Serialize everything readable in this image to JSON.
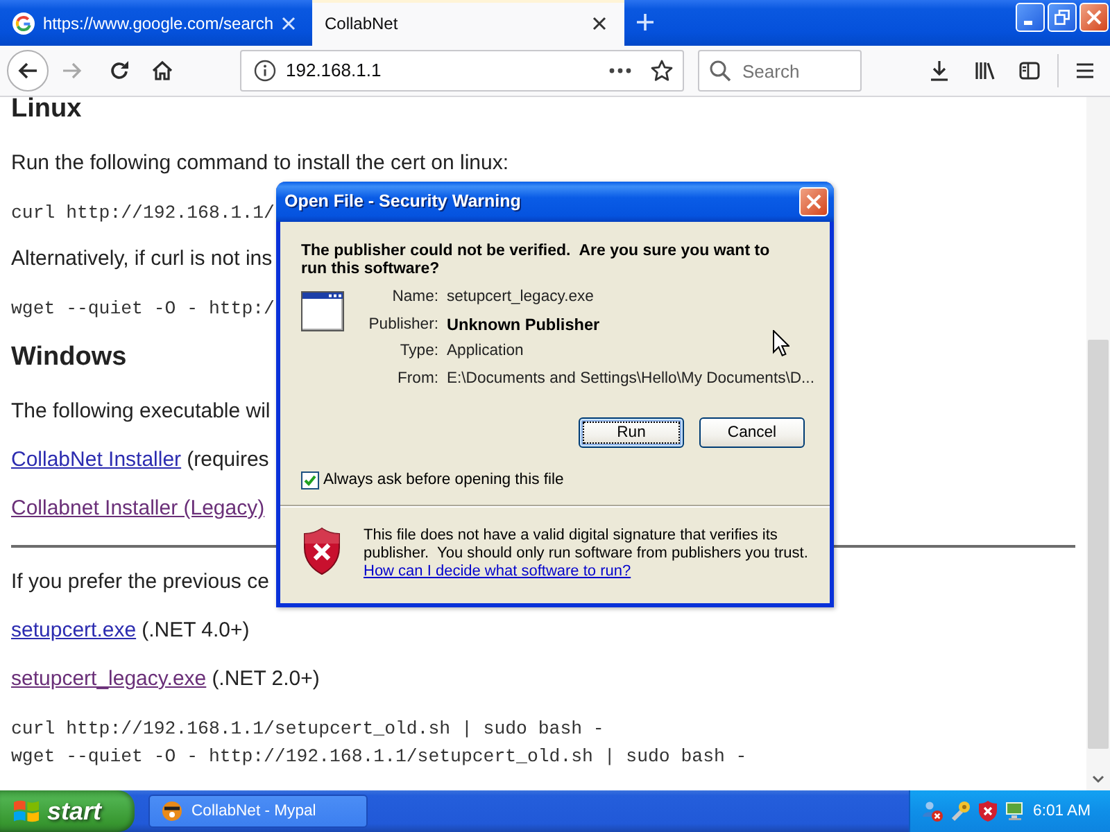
{
  "browser": {
    "tabs": [
      {
        "title": "https://www.google.com/search",
        "favicon": true,
        "selected": false
      },
      {
        "title": "CollabNet",
        "favicon": false,
        "selected": true
      }
    ],
    "url": "192.168.1.1",
    "search": {
      "placeholder": "Search"
    }
  },
  "page": {
    "blocks": [
      {
        "kind": "heading",
        "text": "Linux"
      },
      {
        "kind": "paragraph",
        "text": "Run the following command to install the cert on linux:"
      },
      {
        "kind": "code",
        "lines": [
          "curl http://192.168.1.1/"
        ]
      },
      {
        "kind": "paragraph",
        "text": "Alternatively, if curl is not ins"
      },
      {
        "kind": "code",
        "lines": [
          "wget --quiet -O - http:/"
        ]
      },
      {
        "kind": "heading",
        "text": "Windows"
      },
      {
        "kind": "paragraph",
        "text": "The following executable wil"
      },
      {
        "kind": "link",
        "link": "CollabNet Installer",
        "visited": false,
        "text": "(requires"
      },
      {
        "kind": "link",
        "link": "Collabnet Installer (Legacy)",
        "visited": true
      },
      {
        "kind": "rule"
      },
      {
        "kind": "paragraph",
        "text": "If you prefer the previous ce"
      },
      {
        "kind": "link",
        "link": "setupcert.exe",
        "visited": false,
        "text": "(.NET 4.0+)"
      },
      {
        "kind": "link",
        "link": "setupcert_legacy.exe",
        "visited": true,
        "text": "(.NET 2.0+)"
      },
      {
        "kind": "code",
        "lines": [
          "curl http://192.168.1.1/setupcert_old.sh | sudo bash -",
          "wget --quiet -O - http://192.168.1.1/setupcert_old.sh | sudo bash -"
        ]
      }
    ]
  },
  "dialog": {
    "title": "Open File - Security Warning",
    "message": "The publisher could not be verified.  Are you sure you want to run this software?",
    "fields": [
      {
        "label": "Name:",
        "value": "setupcert_legacy.exe",
        "emphasized": false
      },
      {
        "label": "Publisher:",
        "value": "Unknown Publisher",
        "emphasized": true
      },
      {
        "label": "Type:",
        "value": "Application",
        "emphasized": false
      },
      {
        "label": "From:",
        "value": "E:\\Documents and Settings\\Hello\\My Documents\\D...",
        "emphasized": false
      }
    ],
    "buttons": [
      {
        "label": "Run",
        "focused": true
      },
      {
        "label": "Cancel",
        "focused": false
      }
    ],
    "checkbox": {
      "label": "Always ask before opening this file",
      "checked": true
    },
    "warning": {
      "text": "This file does not have a valid digital signature that verifies its publisher.  You should only run software from publishers you trust.",
      "link": "How can I decide what software to run?"
    }
  },
  "taskbar": {
    "start": "start",
    "tasks": [
      {
        "label": "CollabNet - Mypal",
        "selected": false
      }
    ],
    "clock": "6:01 AM"
  }
}
